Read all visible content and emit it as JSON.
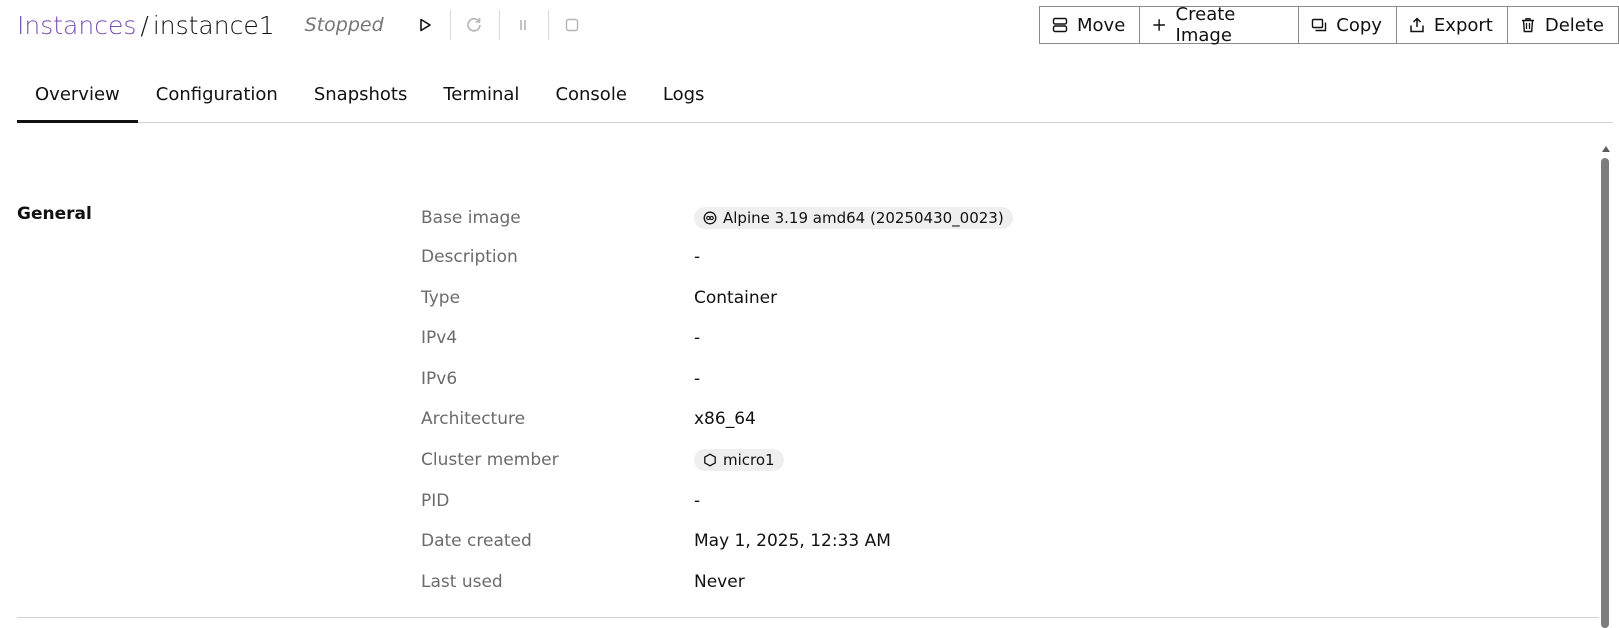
{
  "breadcrumb": {
    "parent": "Instances",
    "separator": "/",
    "current": "instance1"
  },
  "status": "Stopped",
  "controls": {
    "start": "play-icon",
    "restart": "restart-icon",
    "pause": "pause-icon",
    "stop": "stop-icon"
  },
  "actions": {
    "move": "Move",
    "create_image": "Create Image",
    "copy": "Copy",
    "export": "Export",
    "delete": "Delete"
  },
  "tabs": [
    {
      "label": "Overview",
      "active": true
    },
    {
      "label": "Configuration"
    },
    {
      "label": "Snapshots"
    },
    {
      "label": "Terminal"
    },
    {
      "label": "Console"
    },
    {
      "label": "Logs"
    }
  ],
  "general": {
    "title": "General",
    "rows": [
      {
        "label": "Base image",
        "value": "Alpine 3.19 amd64 (20250430_0023)"
      },
      {
        "label": "Description",
        "value": "-"
      },
      {
        "label": "Type",
        "value": "Container"
      },
      {
        "label": "IPv4",
        "value": "-"
      },
      {
        "label": "IPv6",
        "value": "-"
      },
      {
        "label": "Architecture",
        "value": "x86_64"
      },
      {
        "label": "Cluster member",
        "value": "micro1"
      },
      {
        "label": "PID",
        "value": "-"
      },
      {
        "label": "Date created",
        "value": "May 1, 2025, 12:33 AM"
      },
      {
        "label": "Last used",
        "value": "Never"
      }
    ]
  },
  "colors": {
    "link": "#7a4fb0",
    "muted": "#6b6b6b",
    "chip_bg": "#efefef"
  }
}
